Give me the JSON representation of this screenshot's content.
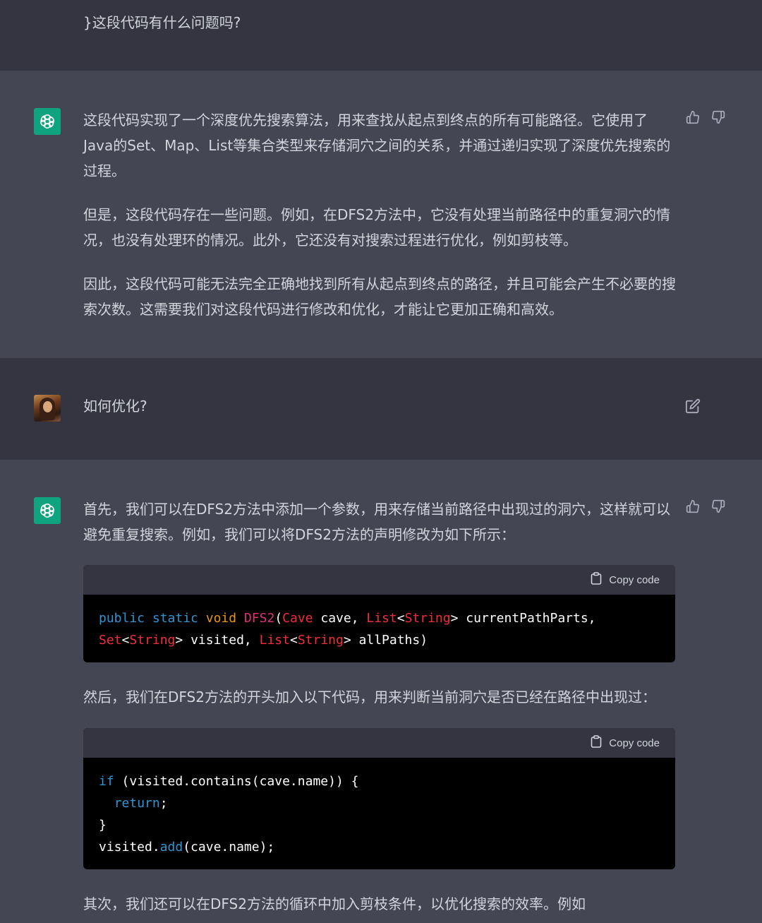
{
  "messages": {
    "user_prev": {
      "text": "}这段代码有什么问题吗?"
    },
    "ai_1": {
      "paragraphs": [
        "这段代码实现了一个深度优先搜索算法，用来查找从起点到终点的所有可能路径。它使用了Java的Set、Map、List等集合类型来存储洞穴之间的关系，并通过递归实现了深度优先搜索的过程。",
        "但是，这段代码存在一些问题。例如，在DFS2方法中，它没有处理当前路径中的重复洞穴的情况，也没有处理环的情况。此外，它还没有对搜索过程进行优化，例如剪枝等。",
        "因此，这段代码可能无法完全正确地找到所有从起点到终点的路径，并且可能会产生不必要的搜索次数。这需要我们对这段代码进行修改和优化，才能让它更加正确和高效。"
      ]
    },
    "user_2": {
      "text": "如何优化?"
    },
    "ai_2": {
      "intro": "首先，我们可以在DFS2方法中添加一个参数，用来存储当前路径中出现过的洞穴，这样就可以避免重复搜索。例如，我们可以将DFS2方法的声明修改为如下所示：",
      "code1": {
        "copy_label": "Copy code",
        "tokens": {
          "public": "public",
          "static": "static",
          "void": "void",
          "name": "DFS2",
          "paren": "(",
          "cave_type": "Cave",
          "cave_arg": " cave, ",
          "list1": "List",
          "lt1": "<",
          "string1": "String",
          "gt1": ">",
          "cpp": " currentPathParts,",
          "set": "Set",
          "lt2": "<",
          "string2": "String",
          "gt2": ">",
          "visited": " visited, ",
          "list2": "List",
          "lt3": "<",
          "string3": "String",
          "gt3": ">",
          "allpaths": " allPaths)"
        }
      },
      "middle": "然后，我们在DFS2方法的开头加入以下代码，用来判断当前洞穴是否已经在路径中出现过：",
      "code2": {
        "copy_label": "Copy code",
        "tokens": {
          "if": "if",
          "cond": " (visited.contains(cave.name)) {",
          "indent": "  ",
          "return": "return",
          "semi": ";",
          "close": "}",
          "visited_dot": "visited.",
          "add": "add",
          "add_args": "(cave.name);"
        }
      },
      "outro": "其次，我们还可以在DFS2方法的循环中加入剪枝条件，以优化搜索的效率。例如"
    }
  },
  "icons": {
    "thumbs_up": "thumbs-up-icon",
    "thumbs_down": "thumbs-down-icon",
    "edit": "edit-icon",
    "clipboard": "clipboard-icon",
    "openai_logo": "openai-logo-icon"
  },
  "colors": {
    "user_bg": "#343541",
    "ai_bg": "#444654",
    "avatar_ai": "#10a37f",
    "code_keyword": "#2e95d3",
    "code_type": "#f22c3d",
    "code_function": "#df3079",
    "code_void": "#e9950c"
  }
}
